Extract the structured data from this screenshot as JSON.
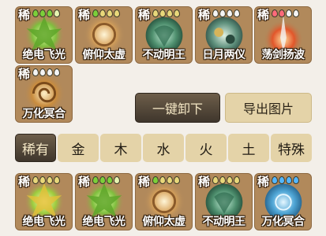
{
  "colors": {
    "card_bg": "#b1895b",
    "btn_dark": "#4f4537",
    "btn_light": "#e4d3a8",
    "page_bg": "#f3efe9"
  },
  "top_cards": [
    {
      "rarity": "稀",
      "name": "绝电飞光",
      "art": "green-lightning-crystal"
    },
    {
      "rarity": "稀",
      "name": "俯仰太虚",
      "art": "golden-swirl-orb"
    },
    {
      "rarity": "稀",
      "name": "不动明王",
      "art": "jade-armor-orb"
    },
    {
      "rarity": "稀",
      "name": "日月两仪",
      "art": "dual-orb"
    },
    {
      "rarity": "稀",
      "name": "荡剑扬波",
      "art": "red-flame-sword"
    },
    {
      "rarity": "稀",
      "name": "万化冥合",
      "art": "golden-spiral"
    }
  ],
  "actions": {
    "one_key_unload": "一键卸下",
    "export_image": "导出图片"
  },
  "tabs": [
    "稀有",
    "金",
    "木",
    "水",
    "火",
    "土",
    "特殊"
  ],
  "bottom_cards": [
    {
      "rarity": "稀",
      "name": "绝电飞光",
      "art": "green-lightning-crystal"
    },
    {
      "rarity": "稀",
      "name": "绝电飞光",
      "art": "green-lightning-crystal"
    },
    {
      "rarity": "稀",
      "name": "俯仰太虚",
      "art": "golden-swirl-orb"
    },
    {
      "rarity": "稀",
      "name": "不动明王",
      "art": "jade-armor-orb"
    },
    {
      "rarity": "稀",
      "name": "万化冥合",
      "art": "blue-orb"
    }
  ]
}
